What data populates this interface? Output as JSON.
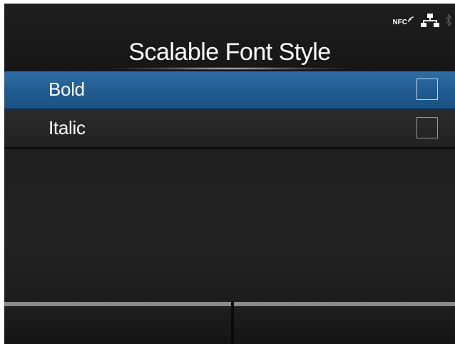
{
  "header": {
    "title": "Scalable Font Style",
    "status_icons": {
      "nfc": "NFC",
      "network_icon": "network-icon",
      "bluetooth_icon": "bluetooth-icon"
    }
  },
  "options": [
    {
      "label": "Bold",
      "checked": false,
      "selected": true
    },
    {
      "label": "Italic",
      "checked": false,
      "selected": false
    }
  ],
  "colors": {
    "selected_row": "#1f5b90",
    "background": "#181818"
  }
}
